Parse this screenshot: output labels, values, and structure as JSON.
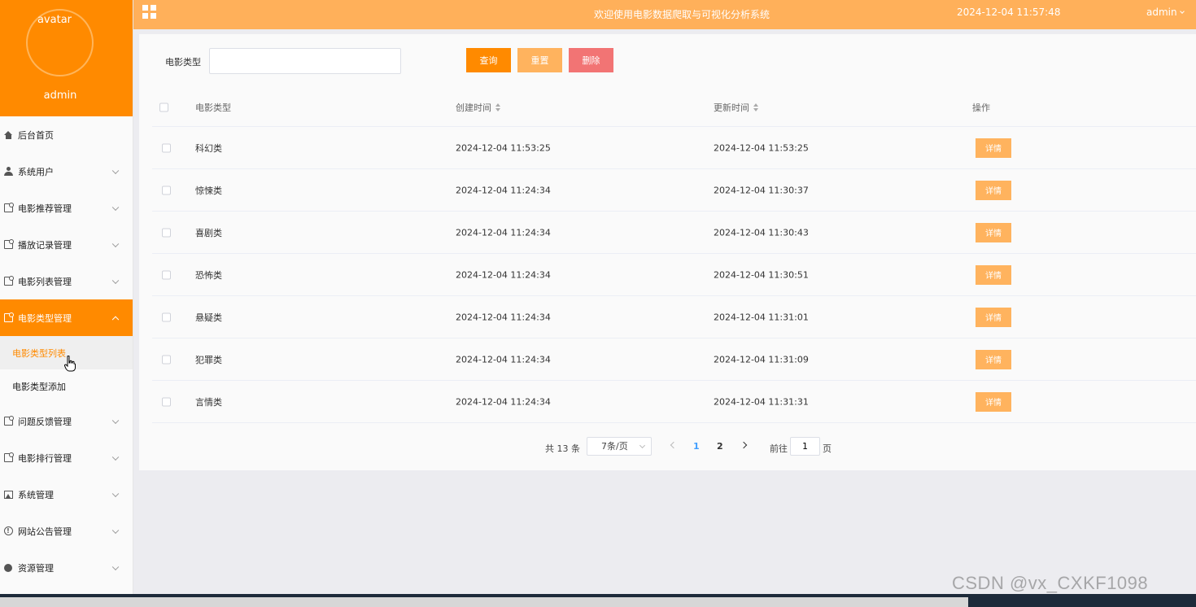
{
  "sidebar": {
    "avatar_text": "avatar",
    "username": "admin",
    "menu": [
      {
        "label": "后台首页",
        "icon": "home-icon"
      },
      {
        "label": "系统用户",
        "icon": "user-icon"
      },
      {
        "label": "电影推荐管理",
        "icon": "document-icon"
      },
      {
        "label": "播放记录管理",
        "icon": "document-icon"
      },
      {
        "label": "电影列表管理",
        "icon": "document-icon"
      },
      {
        "label": "电影类型管理",
        "icon": "document-icon"
      },
      {
        "label": "问题反馈管理",
        "icon": "document-icon"
      },
      {
        "label": "电影排行管理",
        "icon": "document-icon"
      },
      {
        "label": "系统管理",
        "icon": "image-icon"
      },
      {
        "label": "网站公告管理",
        "icon": "info-icon"
      },
      {
        "label": "资源管理",
        "icon": "bulb-icon"
      }
    ],
    "submenu": [
      {
        "label": "电影类型列表"
      },
      {
        "label": "电影类型添加"
      }
    ]
  },
  "header": {
    "title": "欢迎使用电影数据爬取与可视化分析系统",
    "datetime": "2024-12-04 11:57:48",
    "user": "admin"
  },
  "search": {
    "label": "电影类型",
    "value": "",
    "placeholder": "",
    "query_label": "查询",
    "reset_label": "重置",
    "delete_label": "删除"
  },
  "table": {
    "headers": {
      "type": "电影类型",
      "created": "创建时间",
      "updated": "更新时间",
      "operation": "操作"
    },
    "detail_label": "详情",
    "rows": [
      {
        "type": "科幻类",
        "created": "2024-12-04 11:53:25",
        "updated": "2024-12-04 11:53:25"
      },
      {
        "type": "惊悚类",
        "created": "2024-12-04 11:24:34",
        "updated": "2024-12-04 11:30:37"
      },
      {
        "type": "喜剧类",
        "created": "2024-12-04 11:24:34",
        "updated": "2024-12-04 11:30:43"
      },
      {
        "type": "恐怖类",
        "created": "2024-12-04 11:24:34",
        "updated": "2024-12-04 11:30:51"
      },
      {
        "type": "悬疑类",
        "created": "2024-12-04 11:24:34",
        "updated": "2024-12-04 11:31:01"
      },
      {
        "type": "犯罪类",
        "created": "2024-12-04 11:24:34",
        "updated": "2024-12-04 11:31:09"
      },
      {
        "type": "言情类",
        "created": "2024-12-04 11:24:34",
        "updated": "2024-12-04 11:31:31"
      }
    ]
  },
  "pagination": {
    "total": "共 13 条",
    "page_size": "7条/页",
    "pages": [
      "1",
      "2"
    ],
    "current_page": "1",
    "goto_prefix": "前往",
    "goto_value": "1",
    "goto_suffix": "页"
  },
  "overlay": {
    "watermark": "CSDN @vx_CXKF1098"
  },
  "colors": {
    "accent": "#ff8a00",
    "header_bg": "#ffb05a",
    "reset_button": "#ffb35e",
    "delete_button": "#f27474",
    "page_active": "#409eff"
  }
}
